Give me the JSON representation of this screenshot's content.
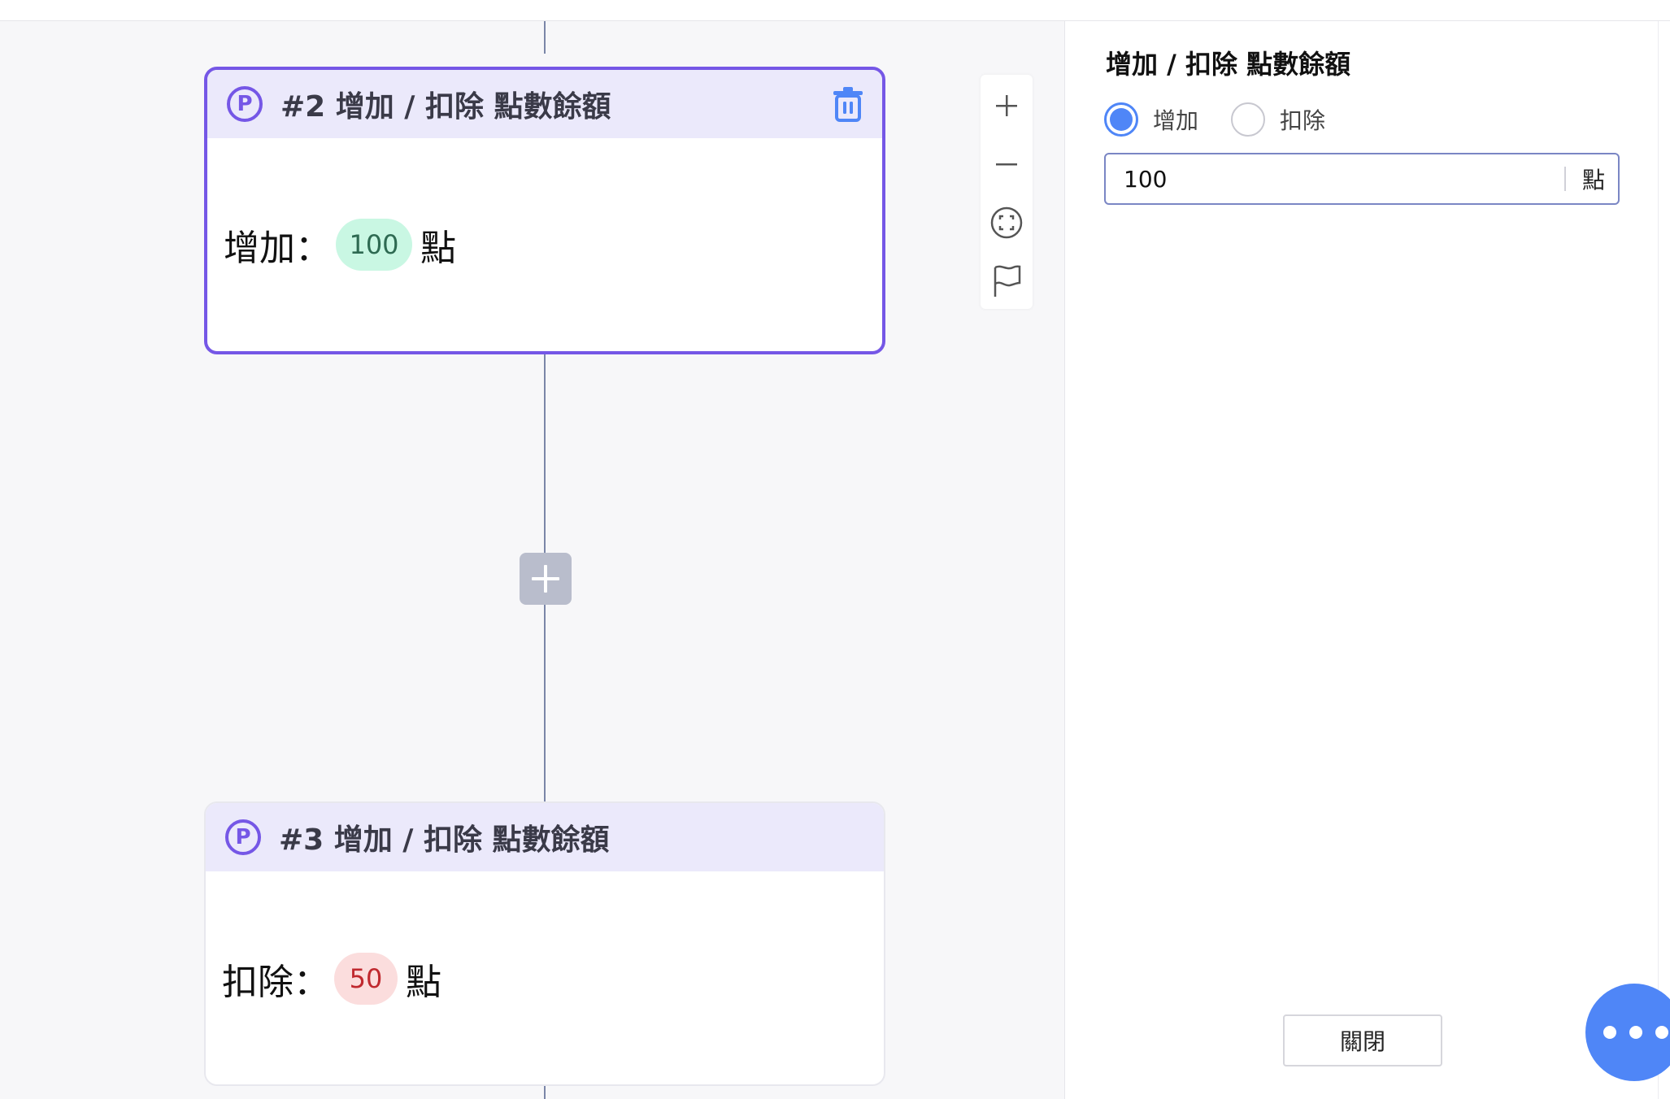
{
  "nodes": [
    {
      "title": "#2 增加 / 扣除 點數餘額",
      "operation_label": "增加：",
      "amount": "100",
      "unit": "點",
      "selected": true,
      "icon": "p-circle-icon",
      "action_icon": "trash-icon"
    },
    {
      "title": "#3 增加 / 扣除 點數餘額",
      "operation_label": "扣除：",
      "amount": "50",
      "unit": "點",
      "selected": false,
      "icon": "p-circle-icon"
    }
  ],
  "zoom_controls": {
    "icons": [
      "zoom-in-icon",
      "zoom-out-icon",
      "fit-view-icon",
      "flag-icon"
    ]
  },
  "panel": {
    "title": "增加 / 扣除 點數餘額",
    "radio_options": [
      {
        "label": "增加",
        "checked": true
      },
      {
        "label": "扣除",
        "checked": false
      }
    ],
    "amount_value": "100",
    "amount_unit": "點",
    "close_label": "關閉"
  },
  "colors": {
    "accent_purple": "#7557e6",
    "header_bg": "#ebe9fb",
    "primary_blue": "#4f86f7",
    "add_pill_bg": "#c9f7e3",
    "deduct_pill_bg": "#fbdddd",
    "connector": "#7a86a8"
  }
}
